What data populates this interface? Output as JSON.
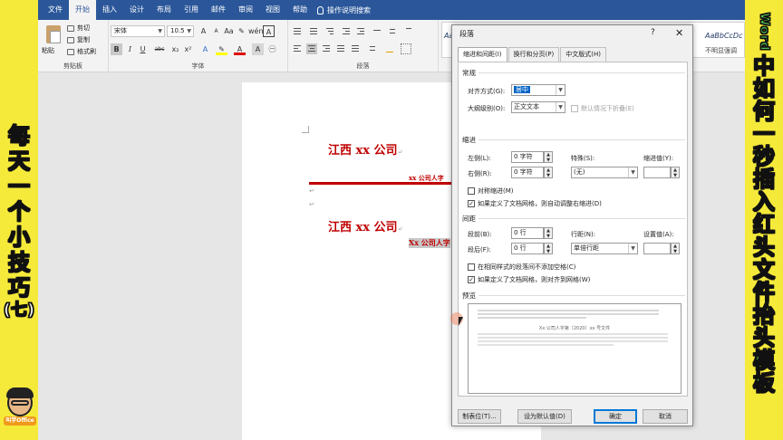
{
  "left_banner": {
    "chars": [
      "每",
      "天",
      "一",
      "个",
      "小",
      "技",
      "巧",
      "(七)"
    ]
  },
  "right_banner": {
    "latin": "Word",
    "chars": [
      "中",
      "如",
      "何",
      "一",
      "秒",
      "插",
      "入",
      "红",
      "头",
      "文",
      "件",
      "抬",
      "头",
      "模",
      "板"
    ]
  },
  "avatar": {
    "label": "叫学Office"
  },
  "word": {
    "tabs": [
      "文件",
      "开始",
      "插入",
      "设计",
      "布局",
      "引用",
      "邮件",
      "审阅",
      "视图",
      "帮助"
    ],
    "active_tab": "开始",
    "tell_me": "操作说明搜索",
    "clipboard": {
      "paste": "粘贴",
      "cut": "剪切",
      "copy": "复制",
      "format_painter": "格式刷",
      "group": "剪贴板"
    },
    "font": {
      "name": "宋体",
      "size": "10.5",
      "group": "字体",
      "buttons": [
        "B",
        "I",
        "U",
        "abc",
        "x₂",
        "x²",
        "A",
        "A",
        "Aa",
        "wén",
        "A"
      ]
    },
    "paragraph": {
      "group": "段落"
    },
    "styles": {
      "sample1": "AaBbCcDd",
      "sample2": "AaBbCcDc",
      "name2": "不明显强调"
    },
    "doc": {
      "title1": "江西 xx 公司",
      "sub1": "xx 公司人字",
      "title2": "江西 xx 公司",
      "sub2": "Xx 公司人字",
      "mark": "↵"
    }
  },
  "dialog": {
    "title": "段落",
    "help": "?",
    "close": "✕",
    "tabs": [
      "缩进和间距(I)",
      "换行和分页(P)",
      "中文版式(H)"
    ],
    "general": {
      "section": "常规",
      "align_label": "对齐方式(G):",
      "align_value": "居中",
      "outline_label": "大纲级别(O):",
      "outline_value": "正文文本",
      "collapsed_default": "默认情况下折叠(E)"
    },
    "indent": {
      "section": "缩进",
      "left_label": "左侧(L):",
      "left_value": "0 字符",
      "right_label": "右侧(R):",
      "right_value": "0 字符",
      "special_label": "特殊(S):",
      "special_value": "(无)",
      "by_label": "缩进值(Y):",
      "by_value": "",
      "mirror": "对称缩进(M)",
      "mirror_checked": false,
      "auto_adjust": "如果定义了文档网格，则自动调整右缩进(D)",
      "auto_adjust_checked": true
    },
    "spacing": {
      "section": "间距",
      "before_label": "段前(B):",
      "before_value": "0 行",
      "after_label": "段后(F):",
      "after_value": "0 行",
      "line_label": "行距(N):",
      "line_value": "单倍行距",
      "at_label": "设置值(A):",
      "at_value": "",
      "no_space_same": "在相同样式的段落间不添加空格(C)",
      "no_space_same_checked": false,
      "snap_grid": "如果定义了文档网格，则对齐到网格(W)",
      "snap_grid_checked": true
    },
    "preview": {
      "section": "预览",
      "center_text": "Xx 公司人字第〔2020〕xx 号文件"
    },
    "buttons": {
      "tabs": "制表位(T)...",
      "set_default": "设为默认值(D)",
      "ok": "确定",
      "cancel": "取消"
    },
    "accent": "#0063c6"
  }
}
